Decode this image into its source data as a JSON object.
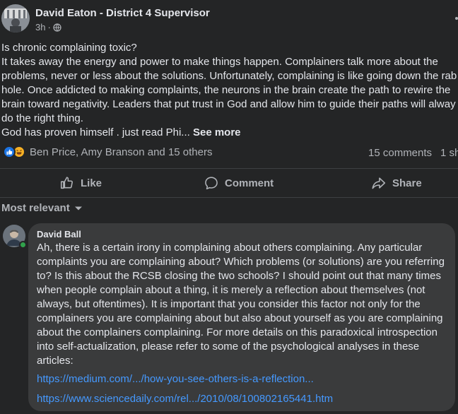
{
  "post": {
    "author": "David Eaton - District 4 Supervisor",
    "time": "3h",
    "privacy_icon": "globe-icon",
    "body_lines": [
      "Is chronic complaining toxic?",
      "It takes away the energy and power to make things happen. Complainers talk more about the",
      "problems, never or less about the solutions. Unfortunately, complaining is like going down the rab",
      "hole. Once addicted to making complaints, the neurons in the brain create the path to rewire the",
      "brain toward negativity. Leaders that put trust in God and allow him to guide their paths will alway",
      "do the right thing."
    ],
    "last_line": "God has proven himself . just read Phi...",
    "see_more": "See more"
  },
  "reactions": {
    "icons": [
      "like-reaction-icon",
      "haha-reaction-icon"
    ],
    "names": "Ben Price, Amy Branson and 15 others",
    "comments": "15 comments",
    "shares": "1 sh"
  },
  "actions": {
    "like": "Like",
    "comment": "Comment",
    "share": "Share"
  },
  "filter": {
    "label": "Most relevant"
  },
  "comment": {
    "author": "David Ball",
    "lines": [
      "Ah, there is a certain irony in complaining about others complaining. Any particular",
      "complaints you are complaining about? Which problems (or solutions) are you referring",
      "to? Is this about the RCSB closing the two schools? I should point out that many times",
      "when people complain about a thing, it is merely a reflection about themselves (not",
      "always, but oftentimes). It is important that you consider this factor not only for the",
      "complainers you are complaining about but also about yourself as you are complaining",
      "about the complainers complaining. For more details on this paradoxical introspection",
      "into self-actualization, please refer to some of the psychological analyses in these",
      "articles:"
    ],
    "link1": "https://medium.com/.../how-you-see-others-is-a-reflection...",
    "link2": "https://www.sciencedaily.com/rel.../2010/08/100802165441.htm"
  },
  "colors": {
    "background": "#242526",
    "bubble": "#3a3b3c",
    "link": "#4599ff",
    "like_blue": "#1b74e4",
    "online_green": "#31a24c"
  }
}
